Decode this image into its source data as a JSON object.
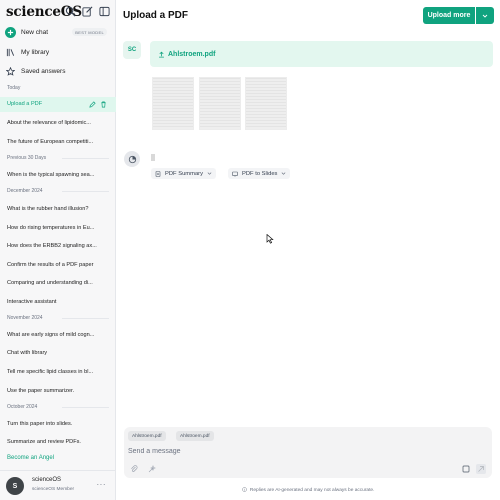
{
  "app": {
    "brand": "scienceOS"
  },
  "sidebar": {
    "new_chat": {
      "label": "New chat",
      "badge": "BEST MODEL"
    },
    "nav": [
      {
        "label": "My library",
        "icon": "library-icon"
      },
      {
        "label": "Saved answers",
        "icon": "star-icon"
      }
    ],
    "sections": {
      "today": "Today",
      "prev30": "Previous 30 Days",
      "dec": "December 2024",
      "nov": "November 2024",
      "oct": "October 2024"
    },
    "today_items": [
      "Upload a PDF",
      "About the relevance of lipidomic...",
      "The future of European competiti..."
    ],
    "prev30_items": [
      "When is the typical spawning sea..."
    ],
    "dec_items": [
      "What is the rubber hand illusion?",
      "How do rising temperatures in Eu...",
      "How does the ERBB2 signaling ax...",
      "Confirm the results of a PDF paper",
      "Comparing and understanding di...",
      "Interactive assistant"
    ],
    "nov_items": [
      "What are early signs of mild cogn...",
      "Chat with library",
      "Tell me specific lipid classes in bl...",
      "Use the paper summarizer."
    ],
    "oct_items": [
      "Turn this paper into slides.",
      "Summarize and review PDFs."
    ],
    "angel_link": "Become an Angel",
    "user": {
      "initial": "S",
      "name": "scienceOS",
      "role": "scienceOS Member",
      "more": "···"
    }
  },
  "main": {
    "title": "Upload a PDF",
    "upload_button": "Upload more",
    "user_initials": "SC",
    "file_name": "Ahlstroem.pdf",
    "actions": [
      {
        "label": "PDF Summary",
        "icon": "document-icon"
      },
      {
        "label": "PDF to Slides",
        "icon": "slides-icon"
      }
    ]
  },
  "composer": {
    "attachments": [
      "Ahlstroem.pdf",
      "Ahlstroem.pdf"
    ],
    "placeholder": "Send a message",
    "disclaimer": "Replies are AI-generated and may not always be accurate."
  },
  "colors": {
    "accent": "#10a37f",
    "accent_light": "#e3f7ef",
    "sidebar_bg": "#f7f7f8"
  }
}
